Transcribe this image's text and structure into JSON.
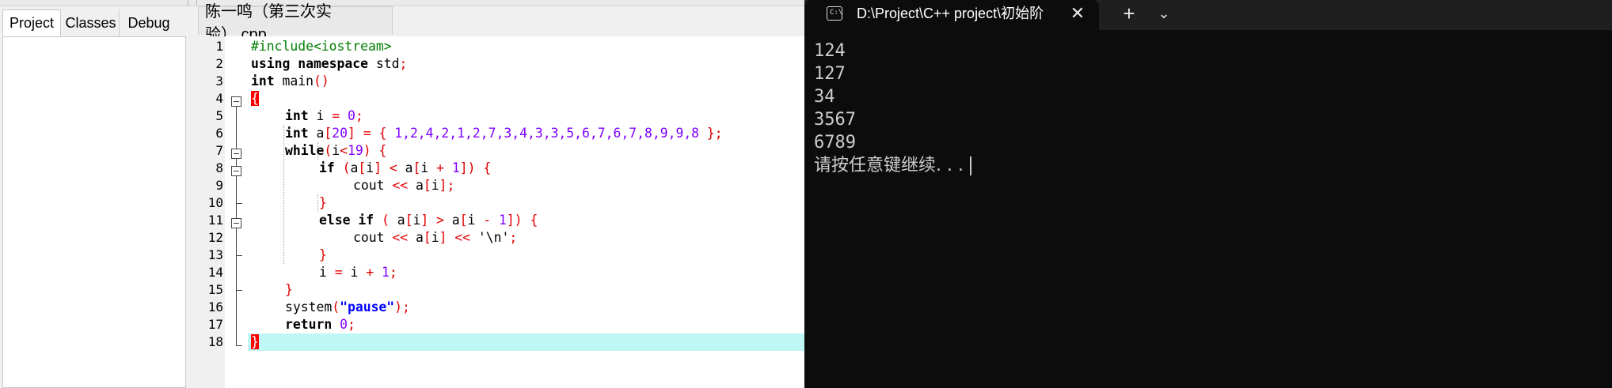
{
  "ide": {
    "project_tabs": [
      "Project",
      "Classes",
      "Debug"
    ],
    "file_tab": "陈一鸣（第三次实验）.cpp",
    "line_numbers": [
      "1",
      "2",
      "3",
      "4",
      "5",
      "6",
      "7",
      "8",
      "9",
      "10",
      "11",
      "12",
      "13",
      "14",
      "15",
      "16",
      "17",
      "18"
    ],
    "code": {
      "l1": "#include<iostream>",
      "l2_kw": "using namespace",
      "l2_rest": " std",
      "l2_semi": ";",
      "l3_kw": "int",
      "l3_rest": " main",
      "l3_paren": "()",
      "l4_brace": "{",
      "l5_kw": "int",
      "l5_rest": " i ",
      "l5_eq": "=",
      "l5_num": "0",
      "l5_semi": ";",
      "l6_kw": "int",
      "l6_rest": " a",
      "l6_open": "[",
      "l6_size": "20",
      "l6_close": "] = { ",
      "l6_values": "1,2,4,2,1,2,7,3,4,3,3,5,6,7,6,7,8,9,9,8",
      "l6_end": " };",
      "l7_kw": "while",
      "l7_open": "(",
      "l7_var": "i",
      "l7_lt": "<",
      "l7_num": "19",
      "l7_end": ") {",
      "l8_kw": "if",
      "l8_a": " (",
      "l8_b": "a",
      "l8_c": "[",
      "l8_d": "i",
      "l8_e": "] < ",
      "l8_f": "a",
      "l8_g": "[",
      "l8_h": "i ",
      "l8_i": "+ ",
      "l8_j": "1",
      "l8_k": "]) {",
      "l9_a": "cout ",
      "l9_b": "<< ",
      "l9_c": "a",
      "l9_d": "[",
      "l9_e": "i",
      "l9_f": "];",
      "l10": "}",
      "l11_kw": "else if",
      "l11_a": " ( ",
      "l11_b": "a",
      "l11_c": "[",
      "l11_d": "i",
      "l11_e": "] > ",
      "l11_f": "a",
      "l11_g": "[",
      "l11_h": "i ",
      "l11_i": "- ",
      "l11_j": "1",
      "l11_k": "]) {",
      "l12_a": "cout ",
      "l12_b": "<< ",
      "l12_c": "a",
      "l12_d": "[",
      "l12_e": "i",
      "l12_f": "] << ",
      "l12_g": "'\\n'",
      "l12_h": ";",
      "l13": "}",
      "l14_a": "i ",
      "l14_b": "= ",
      "l14_c": "i ",
      "l14_d": "+ ",
      "l14_e": "1",
      "l14_f": ";",
      "l15": "}",
      "l16_a": "system",
      "l16_b": "(",
      "l16_c": "\"pause\"",
      "l16_d": ");",
      "l17_kw": "return",
      "l17_sp": " ",
      "l17_num": "0",
      "l17_semi": ";",
      "l18_brace": "}"
    }
  },
  "terminal": {
    "tab_title": "D:\\Project\\C++ project\\初始阶",
    "tab_icon_text": "C:\\",
    "close_glyph": "✕",
    "new_tab_glyph": "+",
    "dropdown_glyph": "⌄",
    "output": [
      "124",
      "127",
      "34",
      "3567",
      "6789"
    ],
    "prompt": "请按任意键继续. . ."
  },
  "colors": {
    "keyword": "#000000",
    "preprocessor": "#008000",
    "operator": "#e00000",
    "number": "#8000ff",
    "string": "#0000ff",
    "current_line": "#bff7f5",
    "brace_match": "#ff0000",
    "terminal_bg": "#0c0c0c",
    "terminal_text": "#cccccc"
  }
}
